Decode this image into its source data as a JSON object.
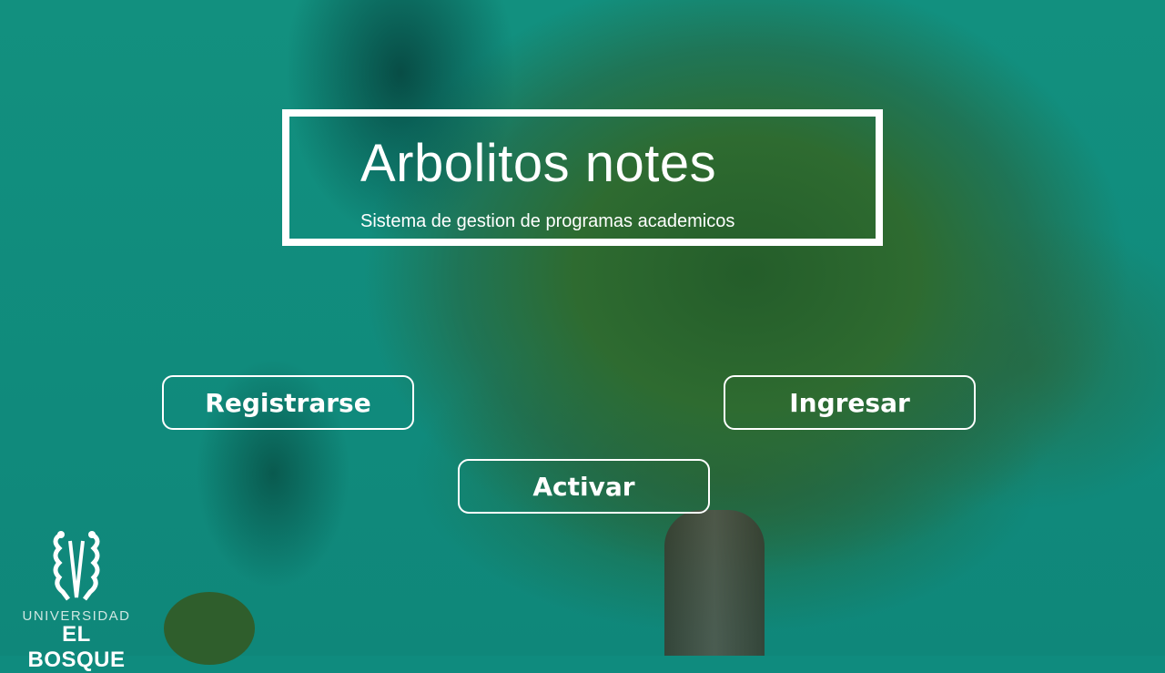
{
  "header": {
    "title": "Arbolitos notes",
    "subtitle": "Sistema de gestion de programas academicos"
  },
  "buttons": {
    "register": "Registrarse",
    "login": "Ingresar",
    "activate": "Activar"
  },
  "logo": {
    "line1": "UNIVERSIDAD",
    "line2": "EL BOSQUE"
  },
  "colors": {
    "background": "#0f8b7e",
    "foliage": "#2e6b30",
    "text": "#ffffff"
  }
}
